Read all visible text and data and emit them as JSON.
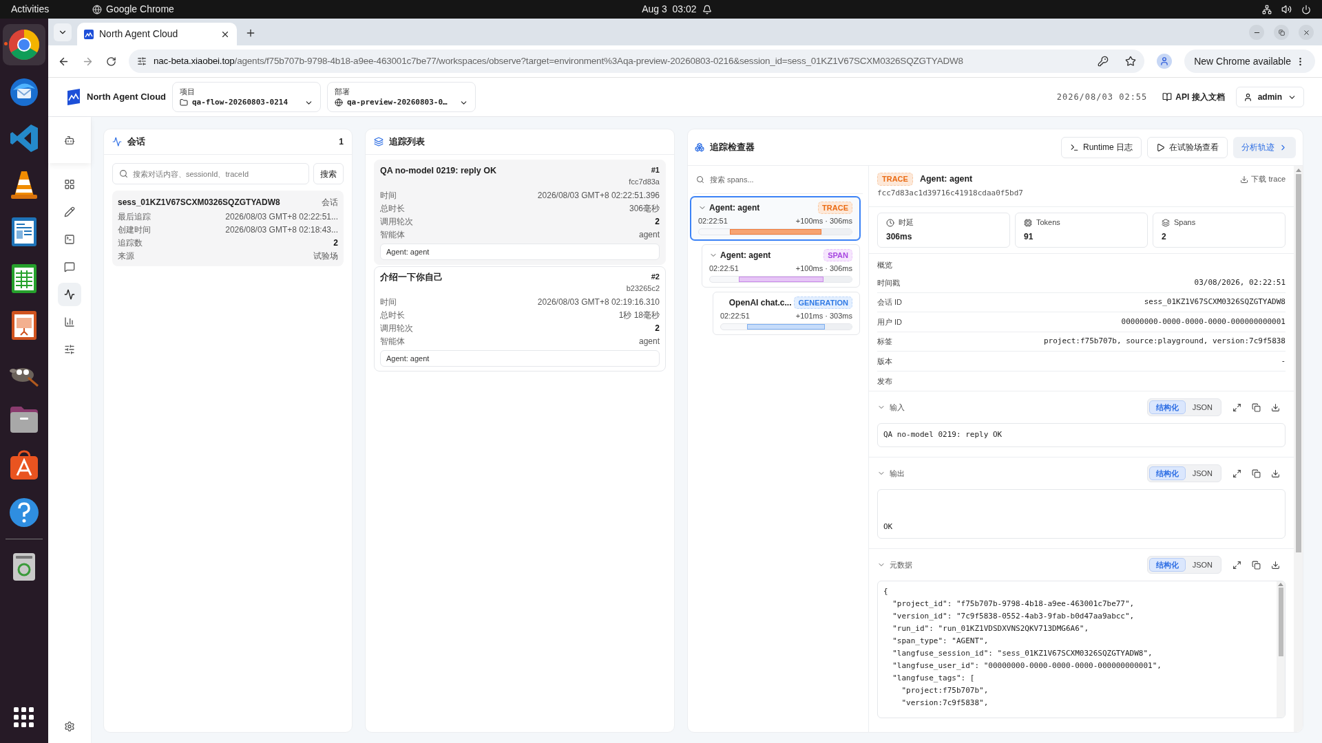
{
  "system_bar": {
    "activities": "Activities",
    "app": "Google Chrome",
    "clock": "Aug 3  03:02"
  },
  "dock": [
    {
      "kind": "chrome",
      "running": true
    },
    {
      "kind": "mail",
      "running": false
    },
    {
      "kind": "code",
      "running": false
    },
    {
      "kind": "cone",
      "running": false
    },
    {
      "kind": "writer",
      "running": false
    },
    {
      "kind": "calc",
      "running": false
    },
    {
      "kind": "impress",
      "running": false
    },
    {
      "kind": "gimp",
      "running": false
    },
    {
      "kind": "files",
      "running": false
    },
    {
      "kind": "store",
      "running": false
    },
    {
      "kind": "help",
      "running": false
    },
    {
      "kind": "trash",
      "running": false
    }
  ],
  "browser": {
    "tabs": [
      {
        "title": "North Agent Cloud",
        "selected": true
      }
    ],
    "url_host": "nac-beta.xiaobei.top",
    "url_path": "/agents/f75b707b-9798-4b18-a9ee-463001c7be77/workspaces/observe?target=environment%3Aqa-preview-20260803-0216&session_id=sess_01KZ1V67SCXM0326SQZGTYADW8",
    "update_button": "New Chrome available"
  },
  "app_header": {
    "brand": "North Agent Cloud",
    "project": {
      "label": "项目",
      "value": "qa-flow-20260803-0214"
    },
    "deployment": {
      "label": "部署",
      "value": "qa-preview-20260803-0…"
    },
    "datetime": "2026/08/03 02:55",
    "docs_link": "API 接入文档",
    "user": "admin"
  },
  "nav": [
    {
      "kind": "bot",
      "selected": false
    },
    {
      "kind": "grid",
      "selected": false
    },
    {
      "kind": "pencil",
      "selected": false
    },
    {
      "kind": "terminal",
      "selected": false
    },
    {
      "kind": "message",
      "selected": false
    },
    {
      "kind": "activity",
      "selected": true
    },
    {
      "kind": "chart",
      "selected": false
    },
    {
      "kind": "sliders",
      "selected": false
    }
  ],
  "sessions_panel": {
    "title": "会话",
    "count": "1",
    "search": {
      "placeholder": "搜索对话内容、sessionId、traceId"
    },
    "search_button": "搜索",
    "items": [
      {
        "id": "sess_01KZ1V67SCXM0326SQZGTYADW8",
        "tag": "会话",
        "selected": true,
        "fields": [
          {
            "label": "最后追踪",
            "value": "2026/08/03 GMT+8 02:22:51...",
            "bold": false
          },
          {
            "label": "创建时间",
            "value": "2026/08/03 GMT+8 02:18:43...",
            "bold": false
          },
          {
            "label": "追踪数",
            "value": "2",
            "bold": true
          },
          {
            "label": "来源",
            "value": "试验场",
            "bold": false
          }
        ]
      }
    ]
  },
  "trace_list": {
    "title": "追踪列表",
    "items": [
      {
        "title": "QA no-model 0219: reply OK",
        "number": "#1",
        "hash": "fcc7d83a",
        "selected": true,
        "fields": [
          {
            "label": "时间",
            "value": "2026/08/03 GMT+8 02:22:51.396",
            "bold": false
          },
          {
            "label": "总时长",
            "value": "306毫秒",
            "bold": false
          },
          {
            "label": "调用轮次",
            "value": "2",
            "bold": true
          },
          {
            "label": "智能体",
            "value": "agent",
            "bold": false
          }
        ],
        "agent_tag": "Agent: agent"
      },
      {
        "title": "介绍一下你自己",
        "number": "#2",
        "hash": "b23265c2",
        "selected": false,
        "fields": [
          {
            "label": "时间",
            "value": "2026/08/03 GMT+8 02:19:16.310",
            "bold": false
          },
          {
            "label": "总时长",
            "value": "1秒 18毫秒",
            "bold": false
          },
          {
            "label": "调用轮次",
            "value": "2",
            "bold": true
          },
          {
            "label": "智能体",
            "value": "agent",
            "bold": false
          }
        ],
        "agent_tag": "Agent: agent"
      }
    ]
  },
  "inspector": {
    "title": "追踪检查器",
    "actions": [
      {
        "kind": "terminal",
        "label": "Runtime 日志"
      },
      {
        "kind": "play",
        "label": "在试验场查看"
      },
      {
        "kind": "primary",
        "label": "分析轨迹"
      }
    ],
    "span_search": {
      "placeholder": "搜索 spans..."
    },
    "spans": [
      {
        "name": "Agent: agent",
        "kind": "trace",
        "badge": "TRACE",
        "time": "02:22:51",
        "timing": "+100ms · 306ms",
        "level": 0.75,
        "selected": true,
        "expanded": true,
        "children": [
          {
            "name": "Agent: agent",
            "kind": "span",
            "badge": "SPAN",
            "time": "02:22:51",
            "timing": "+100ms · 306ms",
            "level": 0.75,
            "selected": false,
            "expanded": true,
            "children": [
              {
                "name": "OpenAI chat.c...",
                "kind": "generation",
                "badge": "GENERATION",
                "time": "02:22:51",
                "timing": "+101ms · 303ms",
                "level": 0.74,
                "selected": false
              }
            ]
          }
        ]
      }
    ],
    "detail": {
      "badge": {
        "kind": "trace",
        "text": "TRACE"
      },
      "title": "Agent: agent",
      "id": "fcc7d83ac1d39716c41918cdaa0f5bd7",
      "download": "下载 trace",
      "stats": [
        {
          "kind": "clock",
          "label": "时延",
          "value": "306ms"
        },
        {
          "kind": "chip",
          "label": "Tokens",
          "value": "91"
        },
        {
          "kind": "layers",
          "label": "Spans",
          "value": "2"
        }
      ],
      "overview_title": "概览",
      "overview": [
        {
          "label": "时间戳",
          "value": "03/08/2026, 02:22:51"
        },
        {
          "label": "会话 ID",
          "value": "sess_01KZ1V67SCXM0326SQZGTYADW8"
        },
        {
          "label": "用户 ID",
          "value": "00000000-0000-0000-0000-000000000001"
        },
        {
          "label": "标签",
          "value": "project:f75b707b, source:playground, version:7c9f5838"
        },
        {
          "label": "版本",
          "value": "-"
        },
        {
          "label": "发布"
        }
      ],
      "sections": [
        {
          "kind": "input",
          "title": "输入",
          "expanded": true,
          "modes": [
            {
              "label": "结构化",
              "selected": true
            },
            {
              "label": "JSON",
              "selected": false
            }
          ],
          "content": "QA no-model 0219: reply OK"
        },
        {
          "kind": "output",
          "title": "输出",
          "expanded": true,
          "modes": [
            {
              "label": "结构化",
              "selected": true
            },
            {
              "label": "JSON",
              "selected": false
            }
          ],
          "content": "OK"
        },
        {
          "kind": "code",
          "title": "元数据",
          "expanded": true,
          "modes": [
            {
              "label": "结构化",
              "selected": true
            },
            {
              "label": "JSON",
              "selected": false
            }
          ],
          "content": "{\n  \"project_id\": \"f75b707b-9798-4b18-a9ee-463001c7be77\",\n  \"version_id\": \"7c9f5838-0552-4ab3-9fab-b0d47aa9abcc\",\n  \"run_id\": \"run_01KZ1VDSDXVNS2QKV713DMG6A6\",\n  \"span_type\": \"AGENT\",\n  \"langfuse_session_id\": \"sess_01KZ1V67SCXM0326SQZGTYADW8\",\n  \"langfuse_user_id\": \"00000000-0000-0000-0000-000000000001\",\n  \"langfuse_tags\": [\n    \"project:f75b707b\",\n    \"version:7c9f5838\","
        }
      ]
    }
  }
}
